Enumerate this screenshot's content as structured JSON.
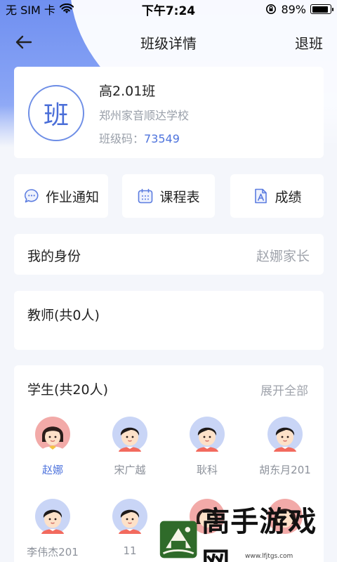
{
  "status_bar": {
    "carrier": "无 SIM 卡",
    "time": "下午7:24",
    "battery": "89%",
    "battery_level": 0.89
  },
  "nav": {
    "title": "班级详情",
    "right_action": "退班",
    "back_icon": "arrow-left-icon"
  },
  "class_info": {
    "avatar_char": "班",
    "name": "高2.01班",
    "school": "郑州家音顺达学校",
    "code_label": "班级码：",
    "code_value": "73549"
  },
  "quick_actions": [
    {
      "label": "作业通知",
      "icon": "chat-bubble-icon"
    },
    {
      "label": "课程表",
      "icon": "calendar-icon"
    },
    {
      "label": "成绩",
      "icon": "grade-document-icon"
    }
  ],
  "identity": {
    "label": "我的身份",
    "value": "赵娜家长"
  },
  "teachers": {
    "label": "教师(共0人)"
  },
  "students": {
    "label": "学生(共20人)",
    "expand": "展开全部",
    "list": [
      {
        "name": "赵娜",
        "avatar": "girl-avatar-icon",
        "active": true
      },
      {
        "name": "宋广越",
        "avatar": "boy-avatar-icon",
        "active": false
      },
      {
        "name": "耿科",
        "avatar": "boy-avatar-icon",
        "active": false
      },
      {
        "name": "胡东月201",
        "avatar": "boy-avatar-icon",
        "active": false
      },
      {
        "name": "李伟杰201",
        "avatar": "boy-avatar-icon",
        "active": false
      },
      {
        "name": "11",
        "avatar": "boy-avatar-icon",
        "active": false
      },
      {
        "name": "",
        "avatar": "girl-avatar-icon",
        "active": false
      },
      {
        "name": "",
        "avatar": "girl-avatar-icon",
        "active": false
      }
    ]
  },
  "watermark": {
    "text": "高手游戏网",
    "url": "www.lfjtgs.com"
  },
  "colors": {
    "accent": "#4f74dd",
    "header_blue": "#7b97f2",
    "muted_text": "#a0a4ac",
    "background": "#f4f6fb"
  }
}
